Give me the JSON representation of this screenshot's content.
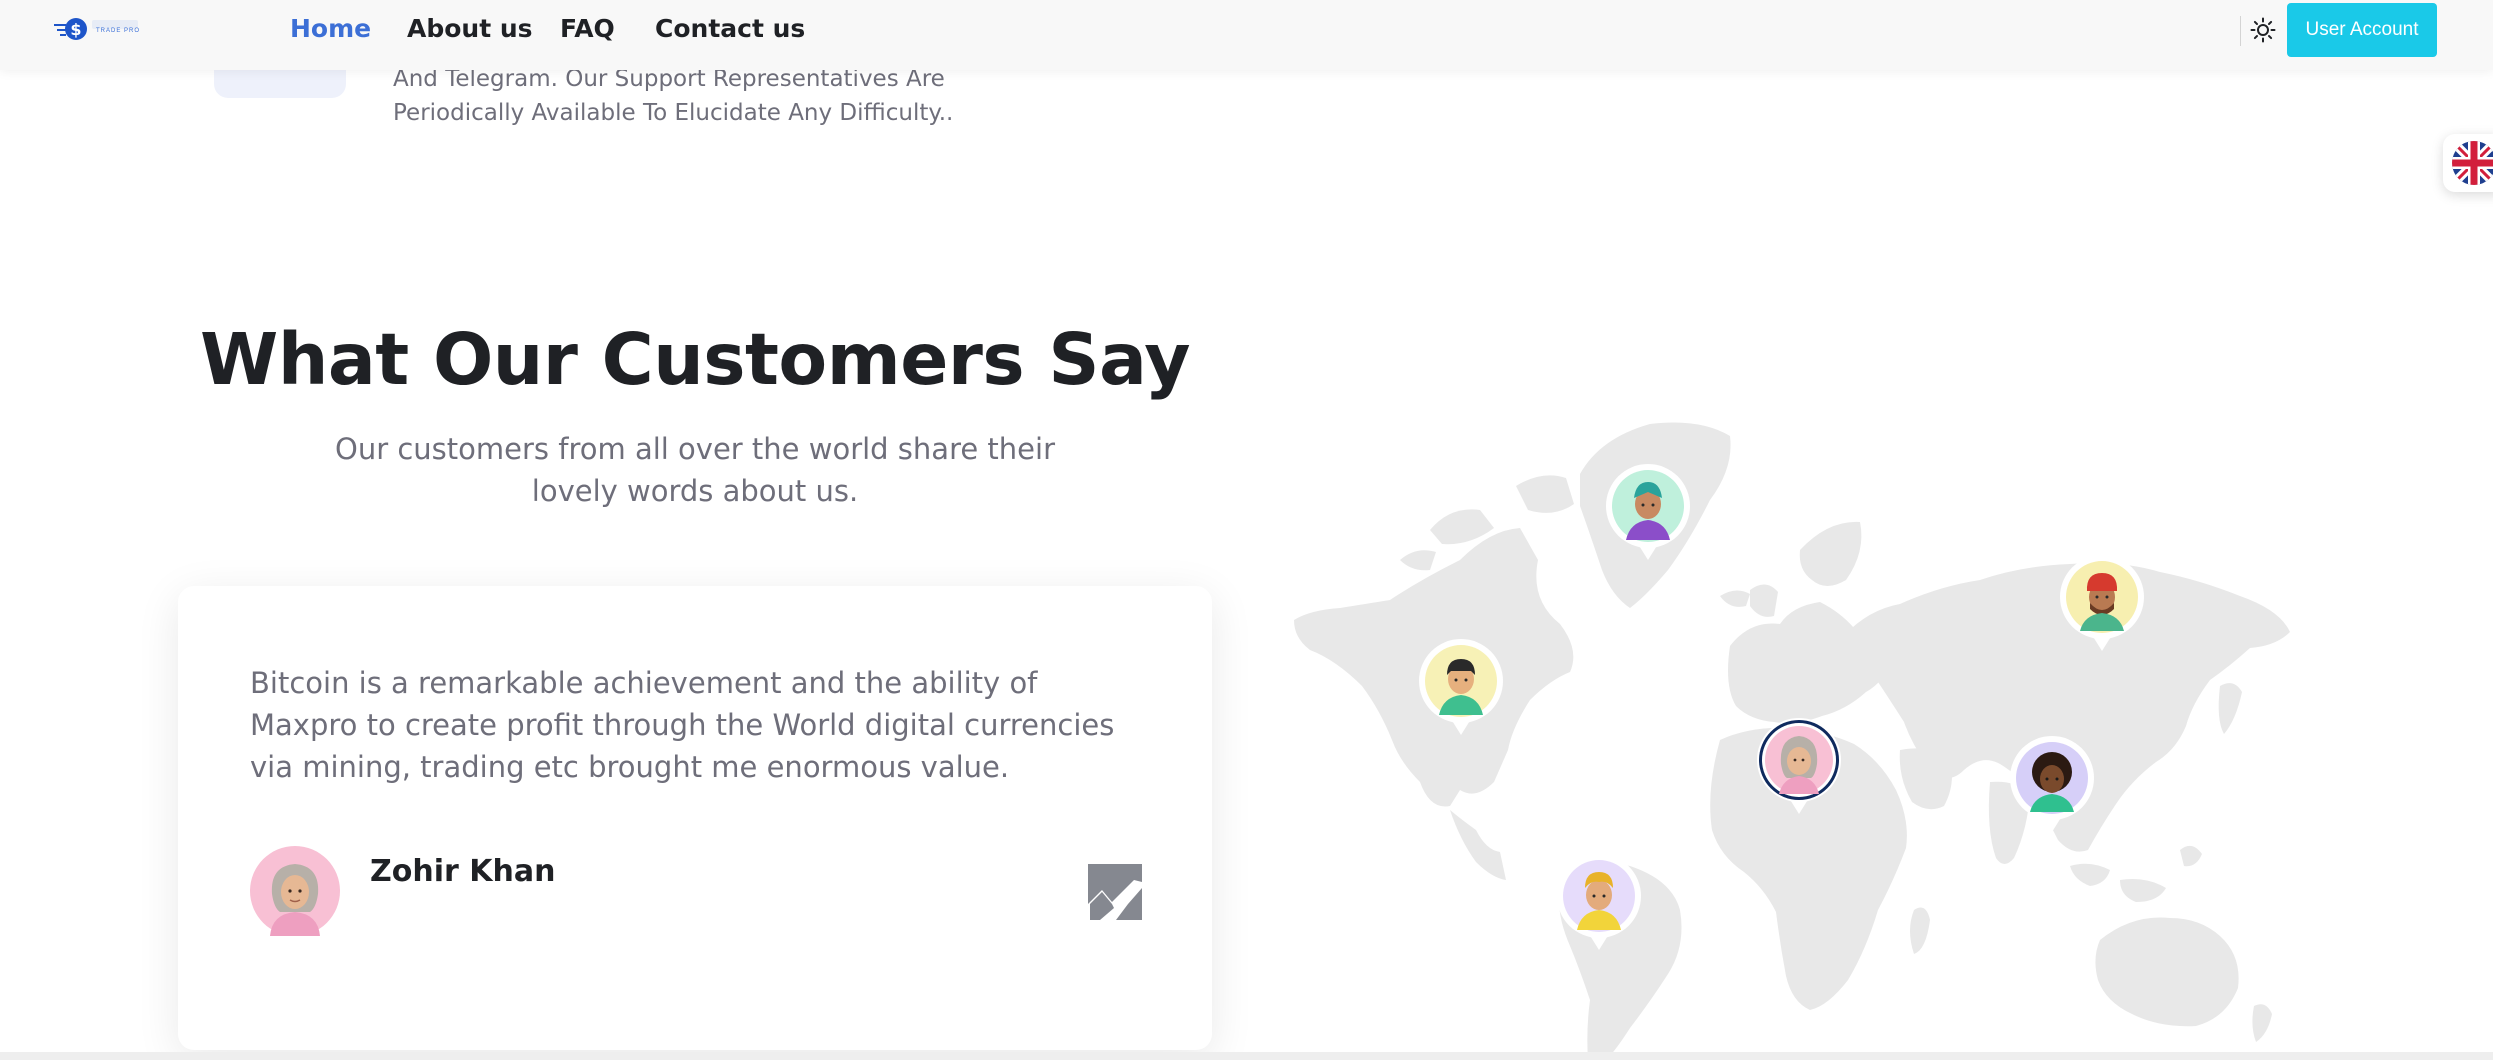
{
  "brand": {
    "logo_caption": "TRADE PRO",
    "accent_color": "#3c6fd6"
  },
  "nav": {
    "items": [
      {
        "label": "Home",
        "active": true
      },
      {
        "label": "About us",
        "active": false
      },
      {
        "label": "FAQ",
        "active": false
      },
      {
        "label": "Contact us",
        "active": false
      }
    ],
    "theme_icon": "sun-icon",
    "user_account_label": "User Account",
    "button_color": "#1ac9e8"
  },
  "support": {
    "text_line1": "And Telegram. Our Support Representatives Are",
    "text_line2": "Periodically Available To Elucidate Any Difficulty.."
  },
  "language": {
    "current": "English",
    "flag_icon": "uk-flag-icon"
  },
  "testimonials": {
    "title": "What Our Customers Say",
    "subtitle_line1": "Our customers from all over the world share their",
    "subtitle_line2": "lovely words about us.",
    "active": {
      "quote": "Bitcoin is a remarkable achievement and the ability of Maxpro to create profit through the World digital currencies via mining, trading etc brought me enormous value.",
      "author": "Zohir Khan",
      "quote_icon": "quote-icon"
    },
    "map_pins": [
      {
        "region": "north-america",
        "avatar_bg": "#f7f1b6",
        "active": false
      },
      {
        "region": "greenland",
        "avatar_bg": "#bff0dc",
        "active": false
      },
      {
        "region": "europe",
        "avatar_bg": "#f8c0d4",
        "active": true
      },
      {
        "region": "south-america",
        "avatar_bg": "#e6dcfb",
        "active": false
      },
      {
        "region": "russia",
        "avatar_bg": "#f7efb0",
        "active": false
      },
      {
        "region": "south-asia",
        "avatar_bg": "#d6cff8",
        "active": false
      }
    ]
  }
}
